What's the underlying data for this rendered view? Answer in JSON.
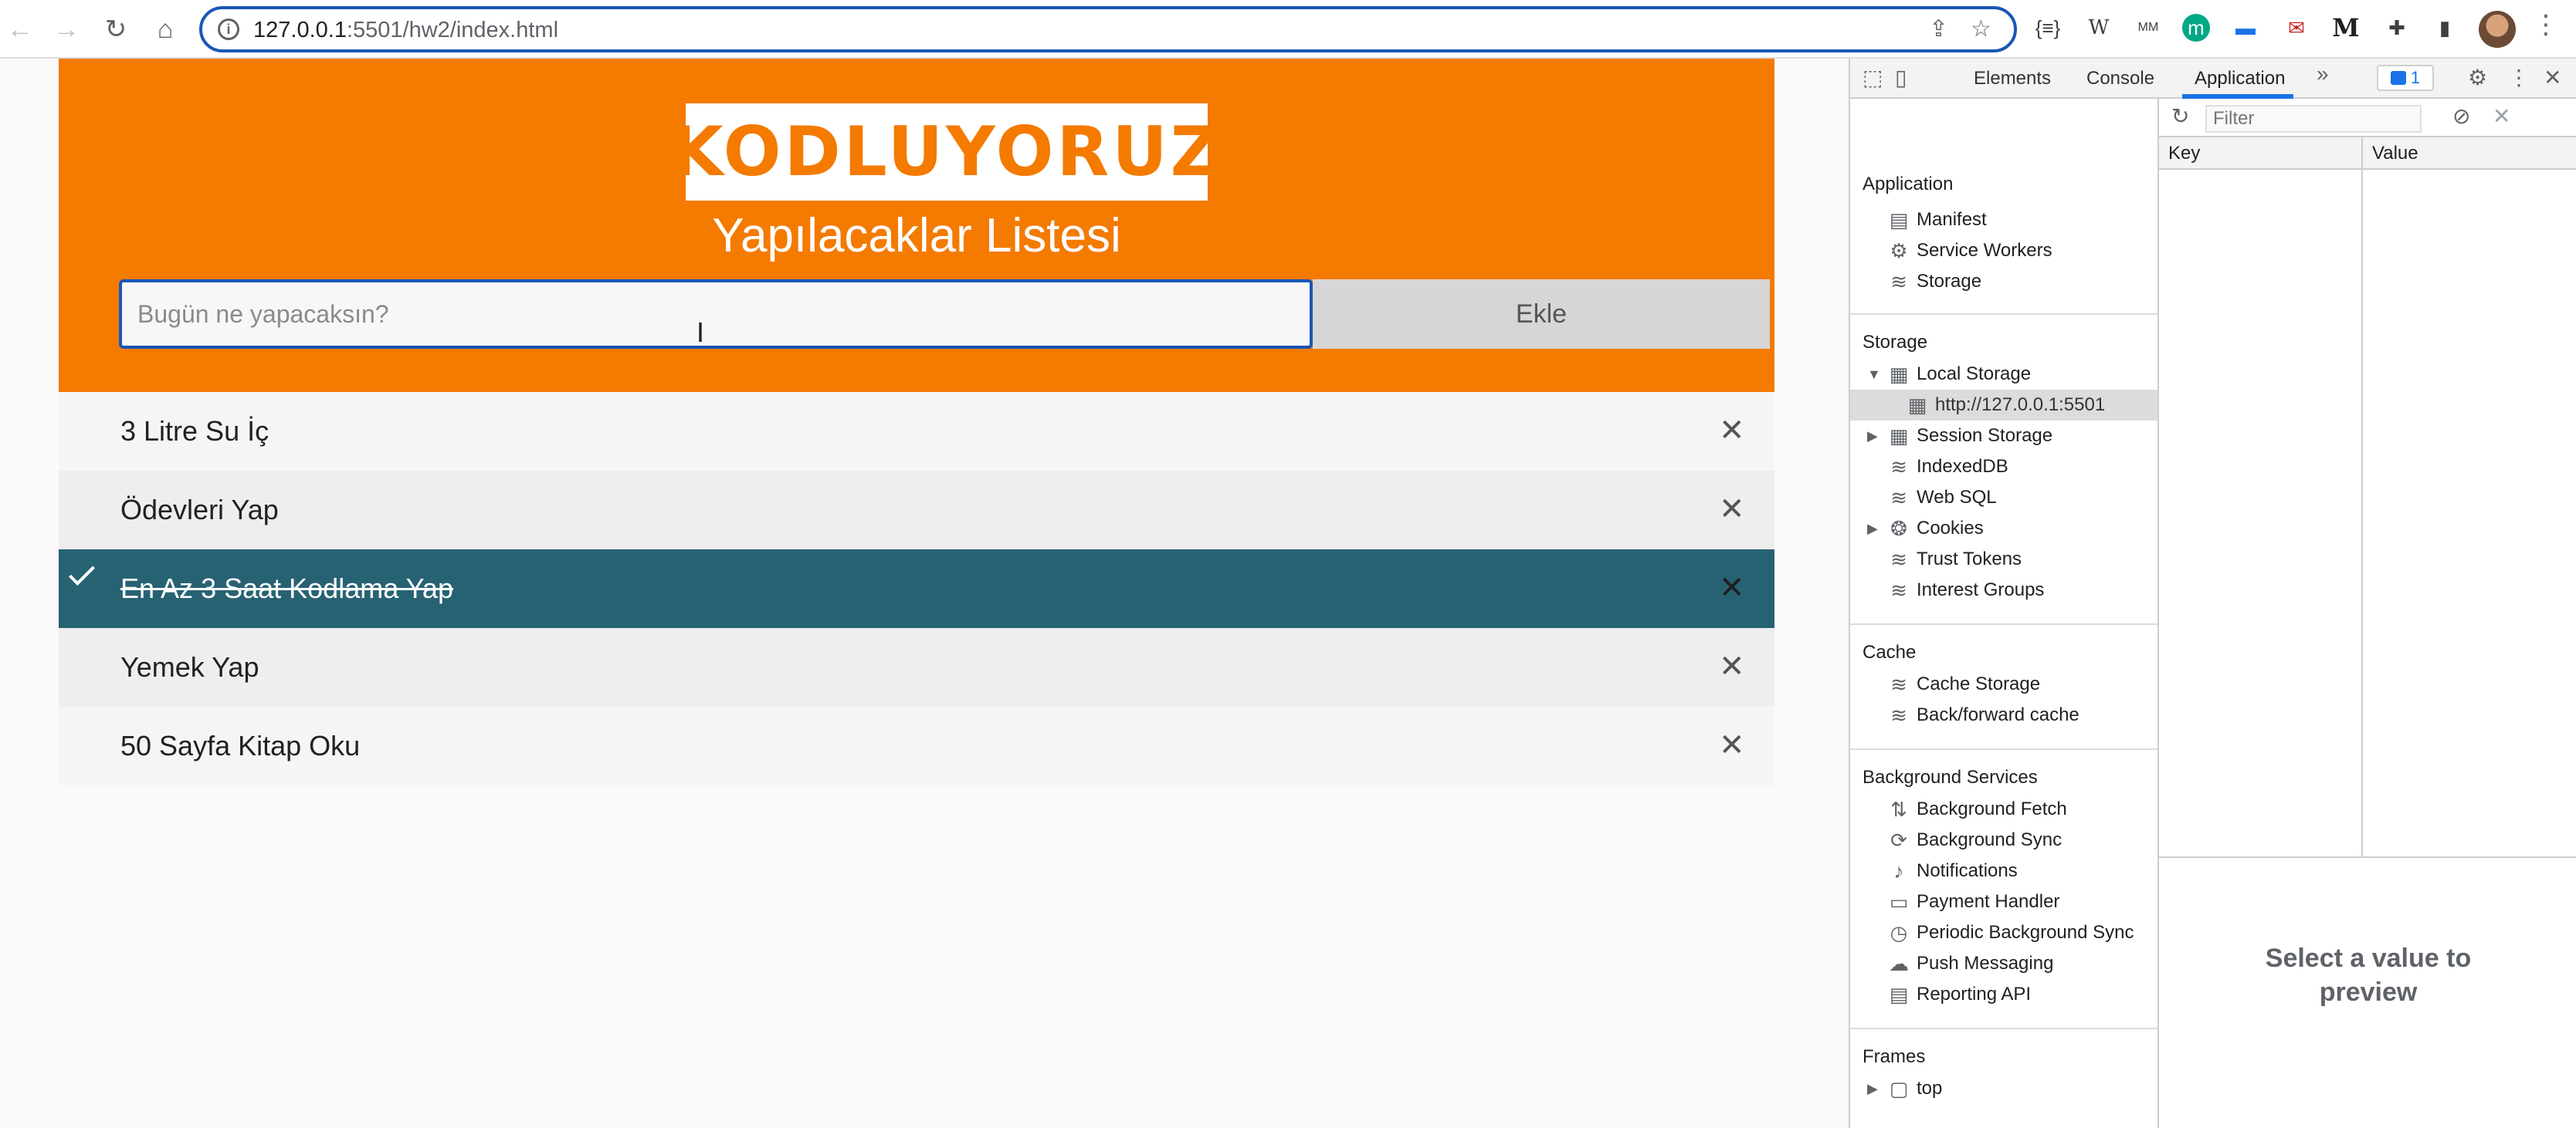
{
  "browser": {
    "url_host": "127.0.0.1",
    "url_rest": ":5501/hw2/index.html",
    "extensions": [
      "{≡}",
      "W",
      "MM",
      "m",
      "▬",
      "✉",
      "M",
      "✚"
    ]
  },
  "app": {
    "logo_text": "KODLUYORUZ",
    "title": "Yapılacaklar Listesi",
    "input_placeholder": "Bugün ne yapacaksın?",
    "add_label": "Ekle",
    "close_symbol": "✕",
    "items": [
      {
        "text": "3 Litre Su İç",
        "checked": false
      },
      {
        "text": "Ödevleri Yap",
        "checked": false
      },
      {
        "text": "En Az 3 Saat Kodlama Yap",
        "checked": true
      },
      {
        "text": "Yemek Yap",
        "checked": false
      },
      {
        "text": "50 Sayfa Kitap Oku",
        "checked": false
      }
    ]
  },
  "devtools": {
    "tabs": [
      "Elements",
      "Console",
      "Application"
    ],
    "active_tab": "Application",
    "more_tabs": "»",
    "issues_count": "1",
    "sections": {
      "application": {
        "title": "Application",
        "items": [
          "Manifest",
          "Service Workers",
          "Storage"
        ]
      },
      "storage": {
        "title": "Storage",
        "local_storage": "Local Storage",
        "local_origin": "http://127.0.0.1:5501",
        "session_storage": "Session Storage",
        "indexeddb": "IndexedDB",
        "websql": "Web SQL",
        "cookies": "Cookies",
        "trust_tokens": "Trust Tokens",
        "interest_groups": "Interest Groups"
      },
      "cache": {
        "title": "Cache",
        "items": [
          "Cache Storage",
          "Back/forward cache"
        ]
      },
      "background": {
        "title": "Background Services",
        "items": [
          "Background Fetch",
          "Background Sync",
          "Notifications",
          "Payment Handler",
          "Periodic Background Sync",
          "Push Messaging",
          "Reporting API"
        ]
      },
      "frames": {
        "title": "Frames",
        "top": "top"
      }
    },
    "filter_placeholder": "Filter",
    "key_header": "Key",
    "value_header": "Value",
    "preview_line1": "Select a value to",
    "preview_line2": "preview"
  }
}
